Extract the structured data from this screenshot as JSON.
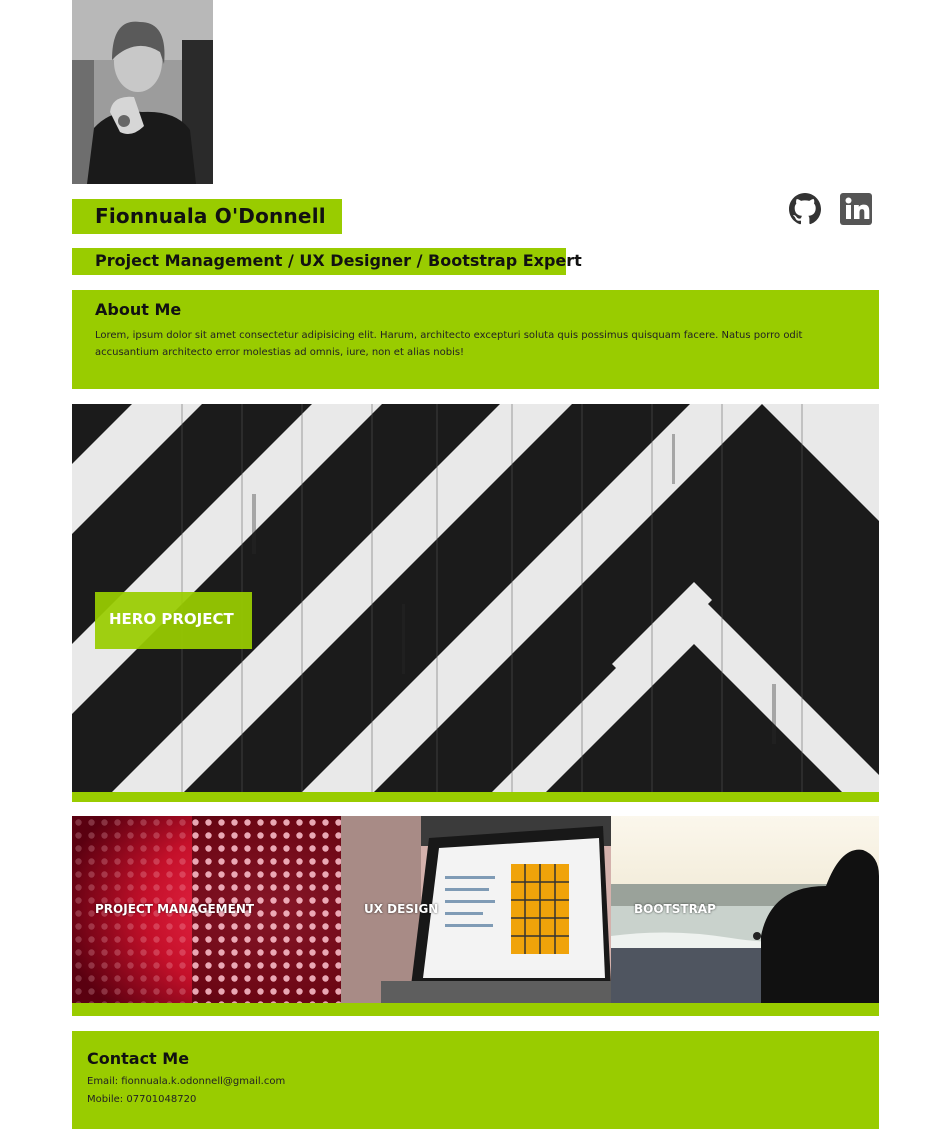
{
  "profile": {
    "name": "Fionnuala O'Donnell",
    "title": "Project Management / UX Designer / Bootstrap Expert"
  },
  "social": [
    {
      "icon": "github-icon"
    },
    {
      "icon": "linkedin-icon"
    }
  ],
  "about": {
    "heading": "About Me",
    "body": "Lorem, ipsum dolor sit amet consectetur adipisicing elit. Harum, architecto excepturi soluta quis possimus quisquam facere. Natus porro odit accusantium architecto error molestias ad omnis, iure, non et alias nobis!"
  },
  "hero": {
    "label": "HERO PROJECT"
  },
  "projects": [
    {
      "label": "PROJECT MANAGEMENT"
    },
    {
      "label": "UX DESIGN"
    },
    {
      "label": "BOOTSTRAP"
    }
  ],
  "contact": {
    "heading": "Contact Me",
    "email": "Email: fionnuala.k.odonnell@gmail.com",
    "mobile": "Mobile: 07701048720"
  },
  "colors": {
    "accent": "#99cc00"
  }
}
